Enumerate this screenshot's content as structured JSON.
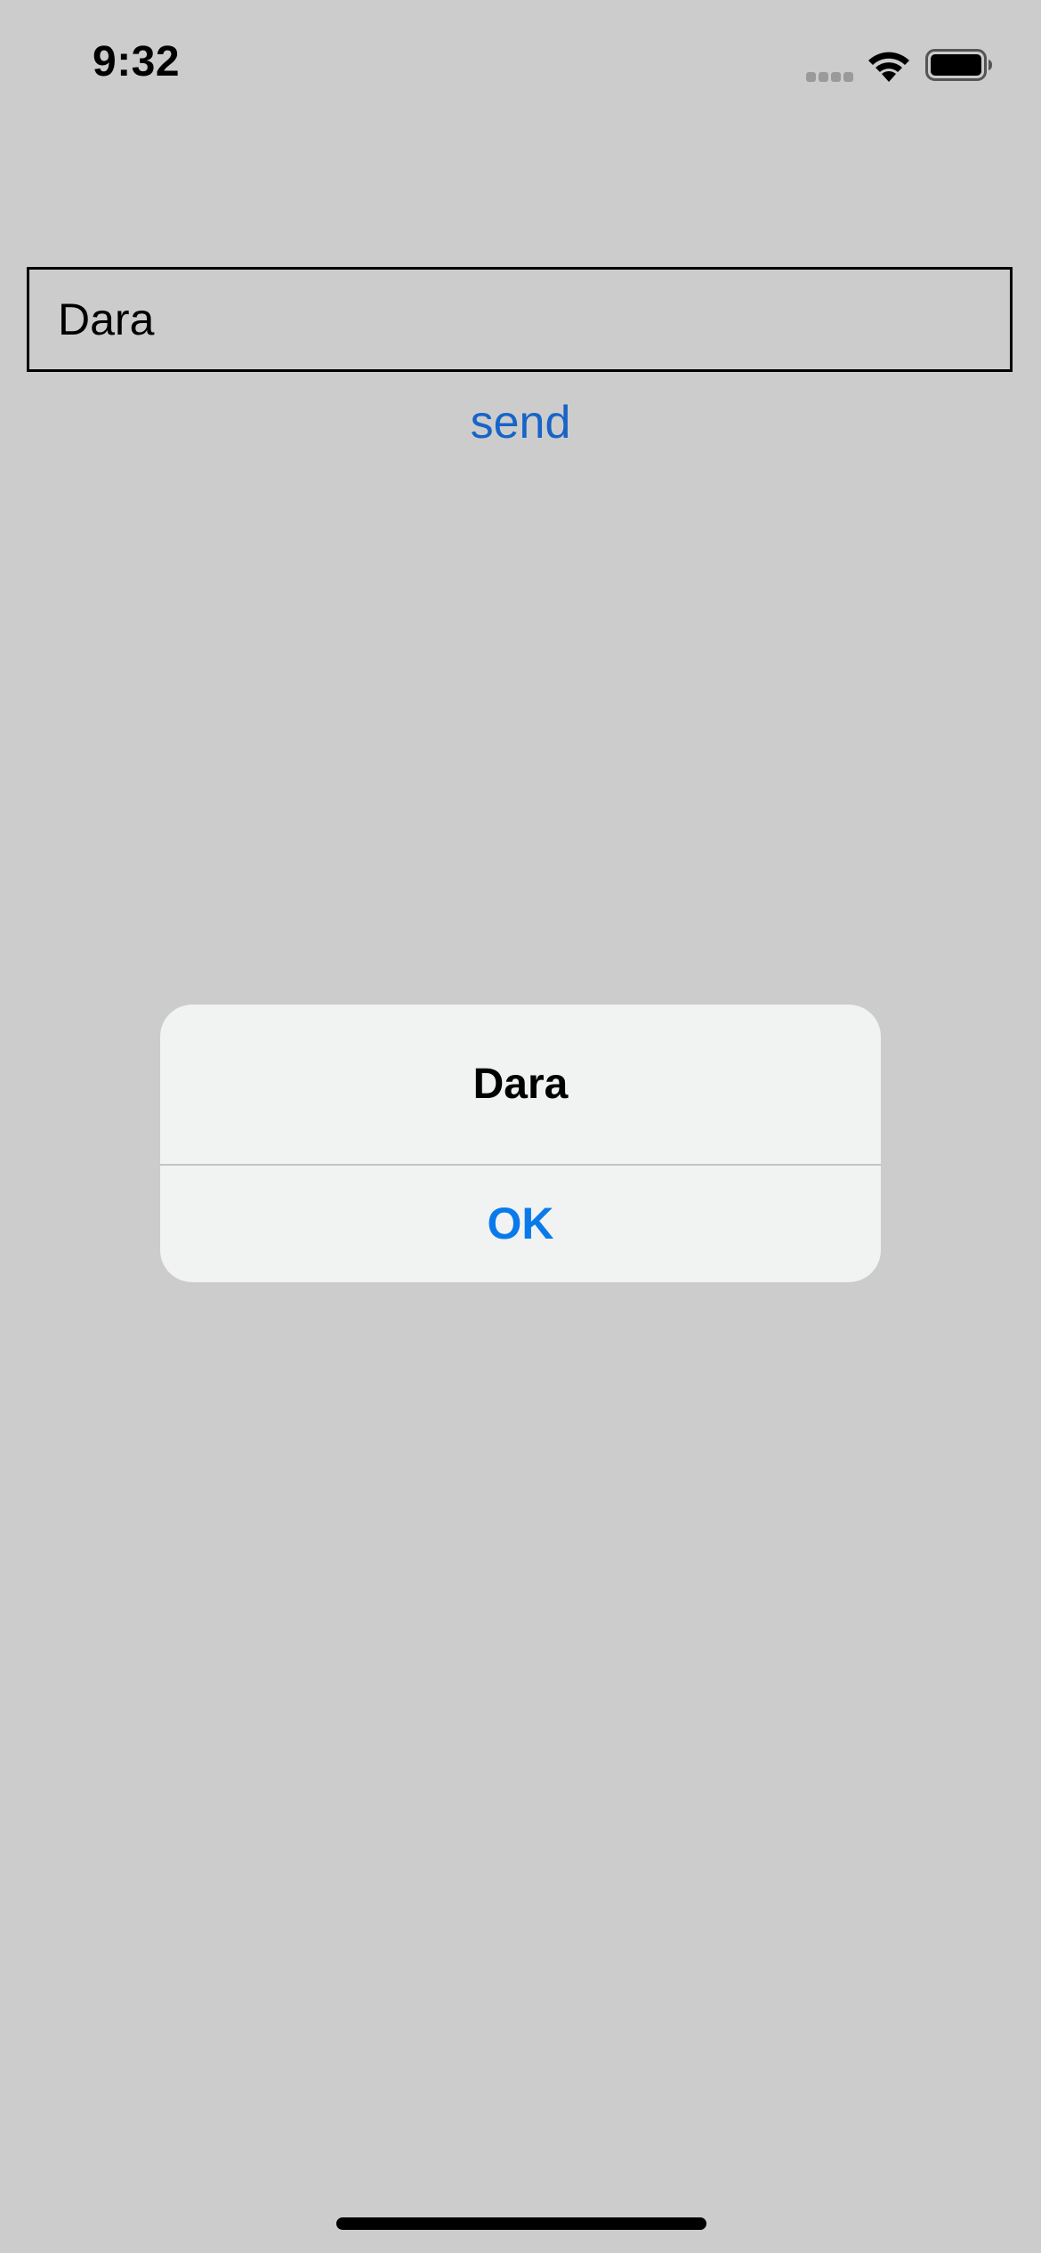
{
  "status_bar": {
    "time": "9:32",
    "signal_icon": "cellular-signal-icon",
    "wifi_icon": "wifi-icon",
    "battery_icon": "battery-icon"
  },
  "form": {
    "input_value": "Dara",
    "send_label": "send"
  },
  "alert": {
    "title": "Dara",
    "ok_label": "OK"
  },
  "colors": {
    "background": "#cccccc",
    "link_blue": "#1664c8",
    "alert_button_blue": "#0a7aeb",
    "alert_background": "#f1f2f2"
  }
}
